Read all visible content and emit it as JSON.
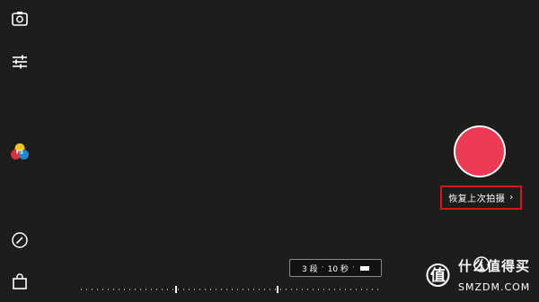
{
  "toolbar": {
    "icons": [
      "camera-flip-icon",
      "adjust-sliders-icon",
      "filter-icon",
      "speed-icon",
      "shopping-bag-icon"
    ]
  },
  "shutter": {
    "color": "#ee3a55"
  },
  "restore_button": {
    "label": "恢复上次拍摄",
    "chevron": "›"
  },
  "segment_selector": {
    "segments": "3 段",
    "separator": "·",
    "duration": "10 秒"
  },
  "watermark": {
    "badge": "值",
    "text": "什么值得买",
    "subtext": "SMZDM.COM"
  },
  "colors": {
    "background": "#1d1d1b",
    "accent_red": "#ee3a55",
    "highlight_box": "#d5151c"
  }
}
